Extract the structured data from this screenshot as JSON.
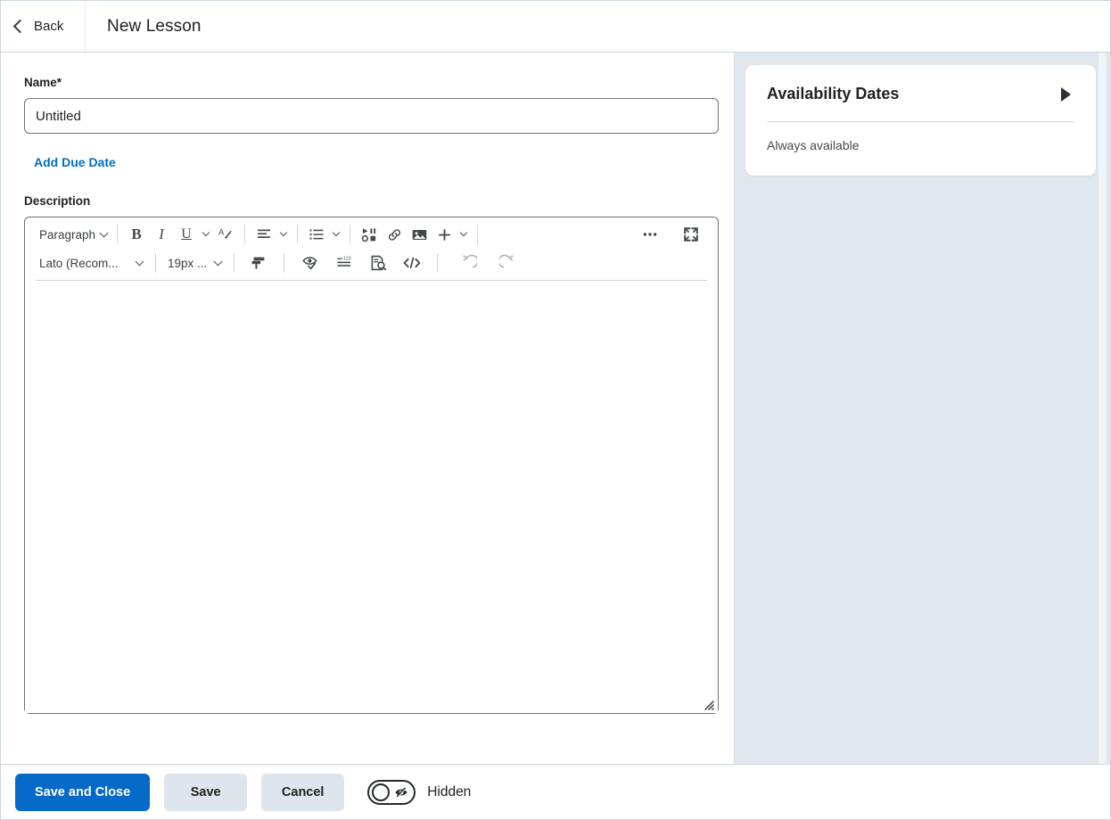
{
  "header": {
    "back_label": "Back",
    "title": "New Lesson",
    "back_icon": "chevron-left-icon"
  },
  "form": {
    "name_label": "Name",
    "name_required_mark": "*",
    "name_value": "Untitled",
    "name_placeholder": "Untitled",
    "add_due_date_label": "Add Due Date",
    "description_label": "Description"
  },
  "editor": {
    "row1": {
      "paragraph_style": "Paragraph",
      "bold": "B",
      "italic": "I",
      "underline": "U",
      "clear_formatting_icon": "a-with-pen-icon",
      "align_icon": "align-left-icon",
      "list_icon": "bulleted-list-icon",
      "insert_stuff_icon": "insert-media-icon",
      "link_icon": "link-icon",
      "image_icon": "image-icon",
      "plus_icon": "plus-icon",
      "more_icon": "ellipsis-icon",
      "fullscreen_icon": "expand-fullscreen-icon"
    },
    "row2": {
      "font_family": "Lato (Recom...",
      "font_size": "19px ...",
      "format_painter_icon": "format-painter-icon",
      "accessibility_icon": "accessibility-check-icon",
      "word_count_icon": "word-count-icon",
      "preview_icon": "preview-document-icon",
      "html_source_icon": "html-source-icon",
      "undo_icon": "undo-icon",
      "redo_icon": "redo-icon"
    },
    "content": "",
    "resize_handle_icon": "resize-grip-icon"
  },
  "side_panel": {
    "card_title": "Availability Dates",
    "expand_icon": "triangle-right-icon",
    "status_text": "Always available"
  },
  "footer": {
    "save_and_close_label": "Save and Close",
    "save_label": "Save",
    "cancel_label": "Cancel",
    "visibility_label": "Hidden",
    "visibility_icon": "eye-slash-icon",
    "visibility_state": "off"
  },
  "colors": {
    "primary_blue": "#0569c8",
    "link_blue": "#006fbf",
    "side_panel_bg": "#e1e7ef",
    "secondary_btn_bg": "#dfe5ec",
    "border_gray": "#6e7477",
    "text_dark": "#202122"
  }
}
